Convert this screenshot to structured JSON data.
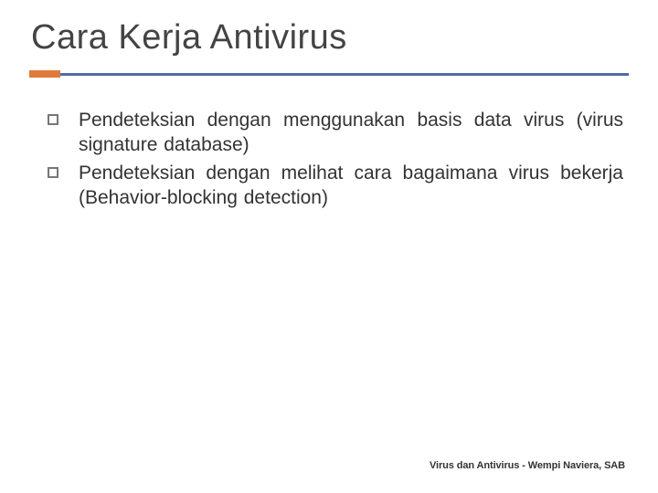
{
  "title": "Cara Kerja Antivirus",
  "bullets": [
    "Pendeteksian dengan menggunakan basis data virus (virus signature database)",
    "Pendeteksian dengan melihat cara bagaimana virus bekerja (Behavior-blocking detection)"
  ],
  "footer": "Virus dan Antivirus - Wempi Naviera, SAB"
}
